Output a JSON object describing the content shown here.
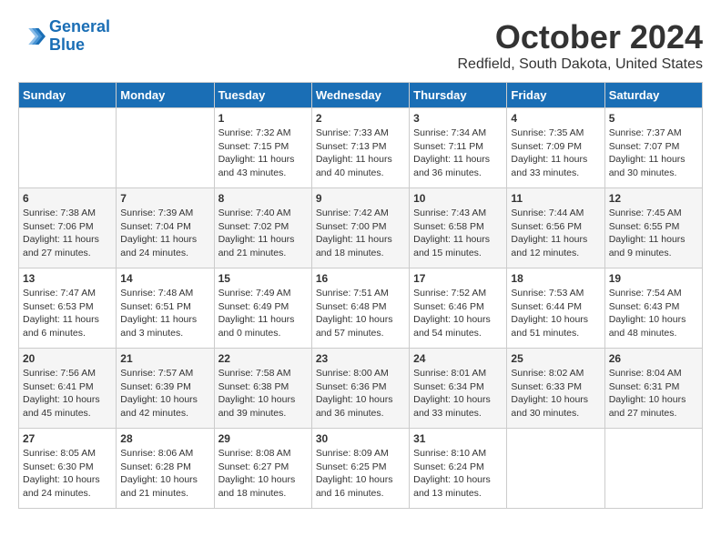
{
  "header": {
    "logo_line1": "General",
    "logo_line2": "Blue",
    "month": "October 2024",
    "location": "Redfield, South Dakota, United States"
  },
  "days_of_week": [
    "Sunday",
    "Monday",
    "Tuesday",
    "Wednesday",
    "Thursday",
    "Friday",
    "Saturday"
  ],
  "weeks": [
    [
      {
        "day": "",
        "info": ""
      },
      {
        "day": "",
        "info": ""
      },
      {
        "day": "1",
        "info": "Sunrise: 7:32 AM\nSunset: 7:15 PM\nDaylight: 11 hours and 43 minutes."
      },
      {
        "day": "2",
        "info": "Sunrise: 7:33 AM\nSunset: 7:13 PM\nDaylight: 11 hours and 40 minutes."
      },
      {
        "day": "3",
        "info": "Sunrise: 7:34 AM\nSunset: 7:11 PM\nDaylight: 11 hours and 36 minutes."
      },
      {
        "day": "4",
        "info": "Sunrise: 7:35 AM\nSunset: 7:09 PM\nDaylight: 11 hours and 33 minutes."
      },
      {
        "day": "5",
        "info": "Sunrise: 7:37 AM\nSunset: 7:07 PM\nDaylight: 11 hours and 30 minutes."
      }
    ],
    [
      {
        "day": "6",
        "info": "Sunrise: 7:38 AM\nSunset: 7:06 PM\nDaylight: 11 hours and 27 minutes."
      },
      {
        "day": "7",
        "info": "Sunrise: 7:39 AM\nSunset: 7:04 PM\nDaylight: 11 hours and 24 minutes."
      },
      {
        "day": "8",
        "info": "Sunrise: 7:40 AM\nSunset: 7:02 PM\nDaylight: 11 hours and 21 minutes."
      },
      {
        "day": "9",
        "info": "Sunrise: 7:42 AM\nSunset: 7:00 PM\nDaylight: 11 hours and 18 minutes."
      },
      {
        "day": "10",
        "info": "Sunrise: 7:43 AM\nSunset: 6:58 PM\nDaylight: 11 hours and 15 minutes."
      },
      {
        "day": "11",
        "info": "Sunrise: 7:44 AM\nSunset: 6:56 PM\nDaylight: 11 hours and 12 minutes."
      },
      {
        "day": "12",
        "info": "Sunrise: 7:45 AM\nSunset: 6:55 PM\nDaylight: 11 hours and 9 minutes."
      }
    ],
    [
      {
        "day": "13",
        "info": "Sunrise: 7:47 AM\nSunset: 6:53 PM\nDaylight: 11 hours and 6 minutes."
      },
      {
        "day": "14",
        "info": "Sunrise: 7:48 AM\nSunset: 6:51 PM\nDaylight: 11 hours and 3 minutes."
      },
      {
        "day": "15",
        "info": "Sunrise: 7:49 AM\nSunset: 6:49 PM\nDaylight: 11 hours and 0 minutes."
      },
      {
        "day": "16",
        "info": "Sunrise: 7:51 AM\nSunset: 6:48 PM\nDaylight: 10 hours and 57 minutes."
      },
      {
        "day": "17",
        "info": "Sunrise: 7:52 AM\nSunset: 6:46 PM\nDaylight: 10 hours and 54 minutes."
      },
      {
        "day": "18",
        "info": "Sunrise: 7:53 AM\nSunset: 6:44 PM\nDaylight: 10 hours and 51 minutes."
      },
      {
        "day": "19",
        "info": "Sunrise: 7:54 AM\nSunset: 6:43 PM\nDaylight: 10 hours and 48 minutes."
      }
    ],
    [
      {
        "day": "20",
        "info": "Sunrise: 7:56 AM\nSunset: 6:41 PM\nDaylight: 10 hours and 45 minutes."
      },
      {
        "day": "21",
        "info": "Sunrise: 7:57 AM\nSunset: 6:39 PM\nDaylight: 10 hours and 42 minutes."
      },
      {
        "day": "22",
        "info": "Sunrise: 7:58 AM\nSunset: 6:38 PM\nDaylight: 10 hours and 39 minutes."
      },
      {
        "day": "23",
        "info": "Sunrise: 8:00 AM\nSunset: 6:36 PM\nDaylight: 10 hours and 36 minutes."
      },
      {
        "day": "24",
        "info": "Sunrise: 8:01 AM\nSunset: 6:34 PM\nDaylight: 10 hours and 33 minutes."
      },
      {
        "day": "25",
        "info": "Sunrise: 8:02 AM\nSunset: 6:33 PM\nDaylight: 10 hours and 30 minutes."
      },
      {
        "day": "26",
        "info": "Sunrise: 8:04 AM\nSunset: 6:31 PM\nDaylight: 10 hours and 27 minutes."
      }
    ],
    [
      {
        "day": "27",
        "info": "Sunrise: 8:05 AM\nSunset: 6:30 PM\nDaylight: 10 hours and 24 minutes."
      },
      {
        "day": "28",
        "info": "Sunrise: 8:06 AM\nSunset: 6:28 PM\nDaylight: 10 hours and 21 minutes."
      },
      {
        "day": "29",
        "info": "Sunrise: 8:08 AM\nSunset: 6:27 PM\nDaylight: 10 hours and 18 minutes."
      },
      {
        "day": "30",
        "info": "Sunrise: 8:09 AM\nSunset: 6:25 PM\nDaylight: 10 hours and 16 minutes."
      },
      {
        "day": "31",
        "info": "Sunrise: 8:10 AM\nSunset: 6:24 PM\nDaylight: 10 hours and 13 minutes."
      },
      {
        "day": "",
        "info": ""
      },
      {
        "day": "",
        "info": ""
      }
    ]
  ]
}
